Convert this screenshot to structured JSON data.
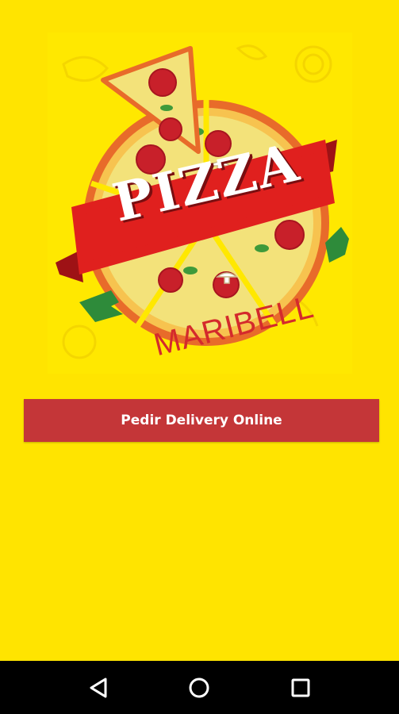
{
  "logo": {
    "title": "PIZZA",
    "subtitle": "MARIBELL"
  },
  "actions": {
    "delivery_label": "Pedir Delivery Online"
  },
  "navigation": {
    "back_icon": "back-triangle-icon",
    "home_icon": "home-circle-icon",
    "recents_icon": "recents-square-icon"
  },
  "colors": {
    "background": "#FFE400",
    "button": "#C43638",
    "ribbon": "#E0201E",
    "navbar": "#000000"
  }
}
